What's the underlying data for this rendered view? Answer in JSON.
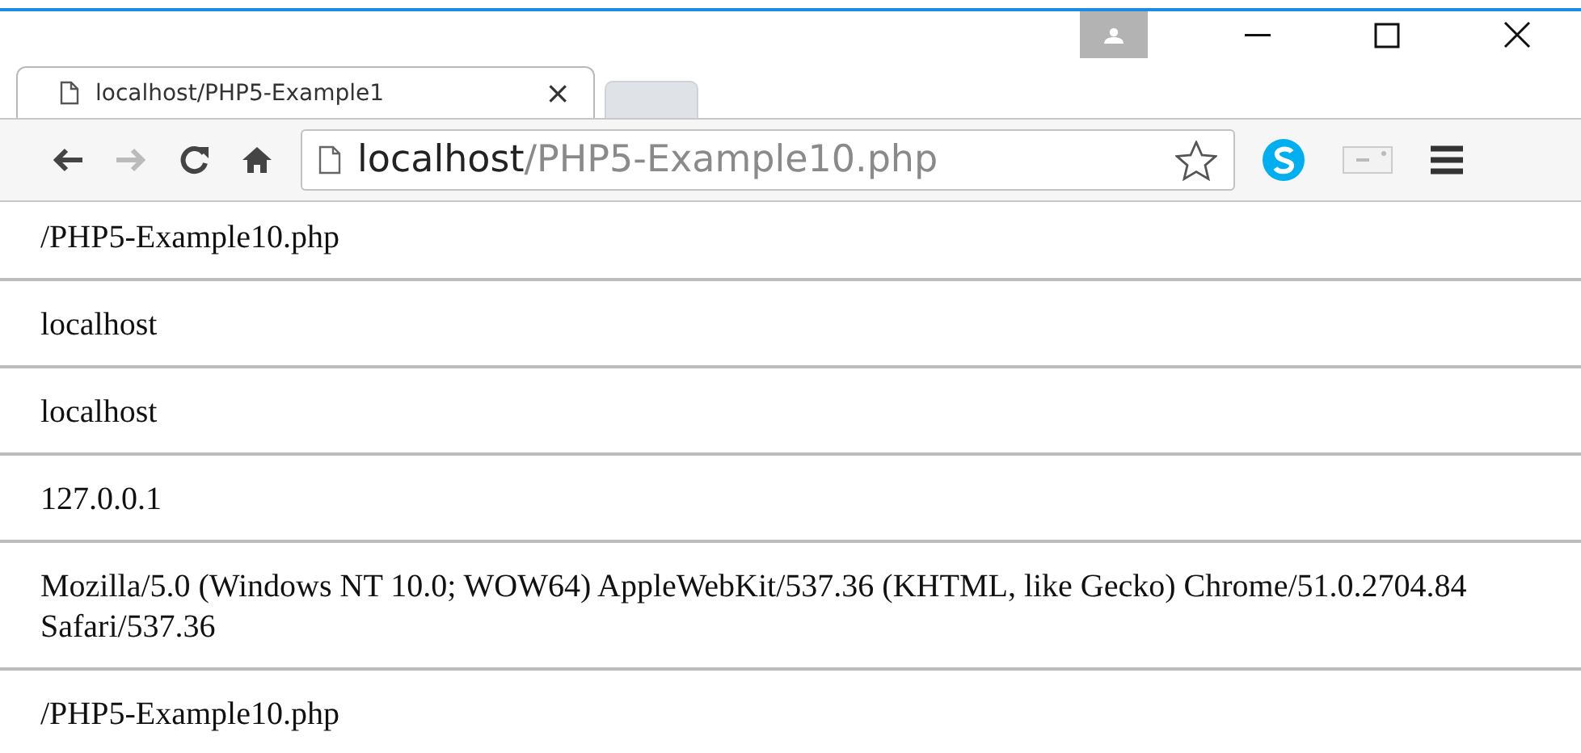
{
  "tab": {
    "title": "localhost/PHP5-Example1",
    "close": "×"
  },
  "address": {
    "host": "localhost",
    "path": "/PHP5-Example10.php"
  },
  "lines": [
    "/PHP5-Example10.php",
    "localhost",
    "localhost",
    "127.0.0.1",
    "Mozilla/5.0 (Windows NT 10.0; WOW64) AppleWebKit/537.36 (KHTML, like Gecko) Chrome/51.0.2704.84 Safari/537.36",
    "/PHP5-Example10.php"
  ]
}
